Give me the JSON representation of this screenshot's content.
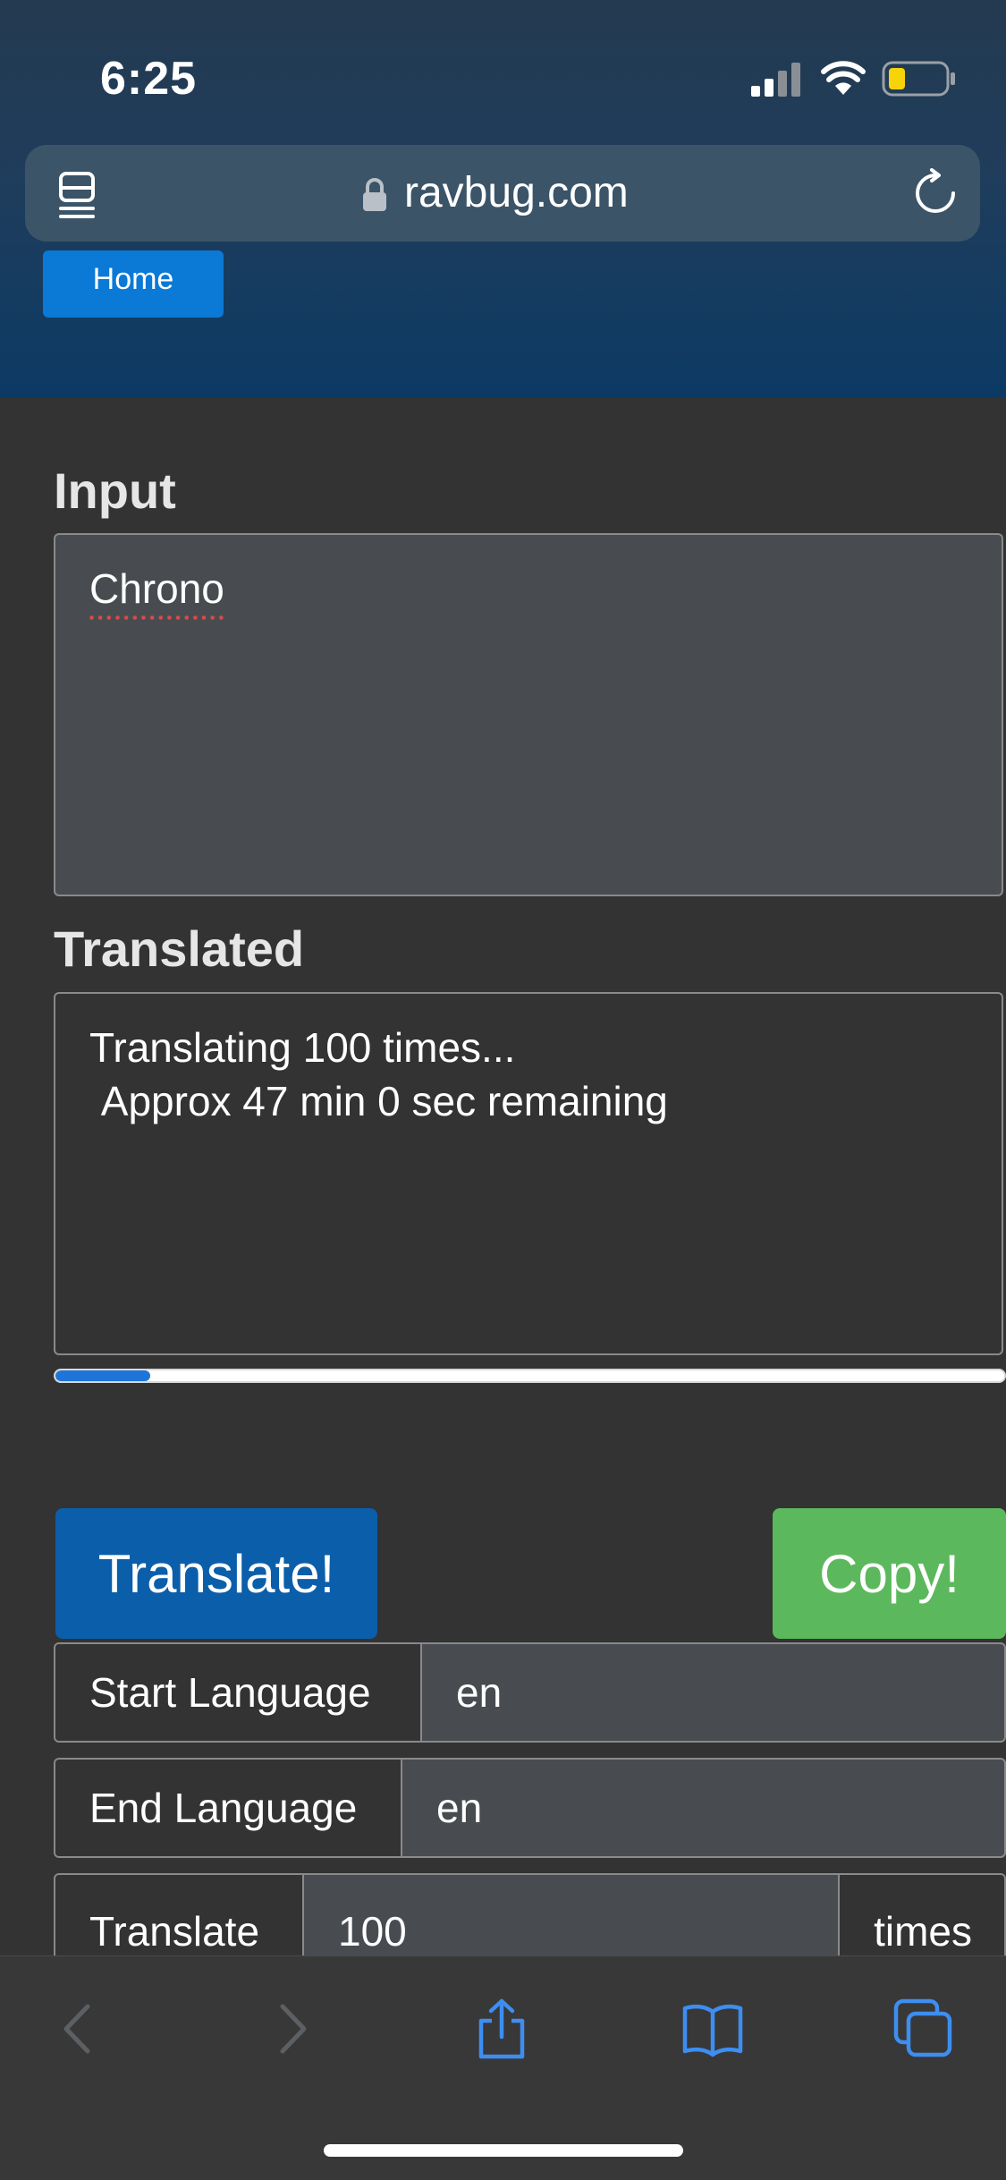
{
  "status_bar": {
    "time": "6:25"
  },
  "browser": {
    "url": "ravbug.com"
  },
  "nav": {
    "home_label": "Home"
  },
  "input": {
    "label": "Input",
    "value": "Chrono"
  },
  "translated": {
    "label": "Translated",
    "text": "Translating 100 times...\n Approx 47 min 0 sec remaining"
  },
  "progress": {
    "fraction": 0.1
  },
  "buttons": {
    "translate": "Translate!",
    "copy": "Copy!"
  },
  "settings": {
    "start_language": {
      "label": "Start Language",
      "value": "en"
    },
    "end_language": {
      "label": "End Language",
      "value": "en"
    },
    "times": {
      "label": "Translate",
      "value": "100",
      "suffix": "times"
    }
  },
  "toolbar": {
    "items": [
      "back-icon",
      "forward-icon",
      "share-icon",
      "bookmarks-icon",
      "tabs-icon"
    ]
  },
  "colors": {
    "translate_button": "#0b5eaa",
    "copy_button": "#5cb85c",
    "progress_fill": "#1e75d9",
    "home_button": "#0b79d6",
    "battery_level": "#f7d30a"
  }
}
